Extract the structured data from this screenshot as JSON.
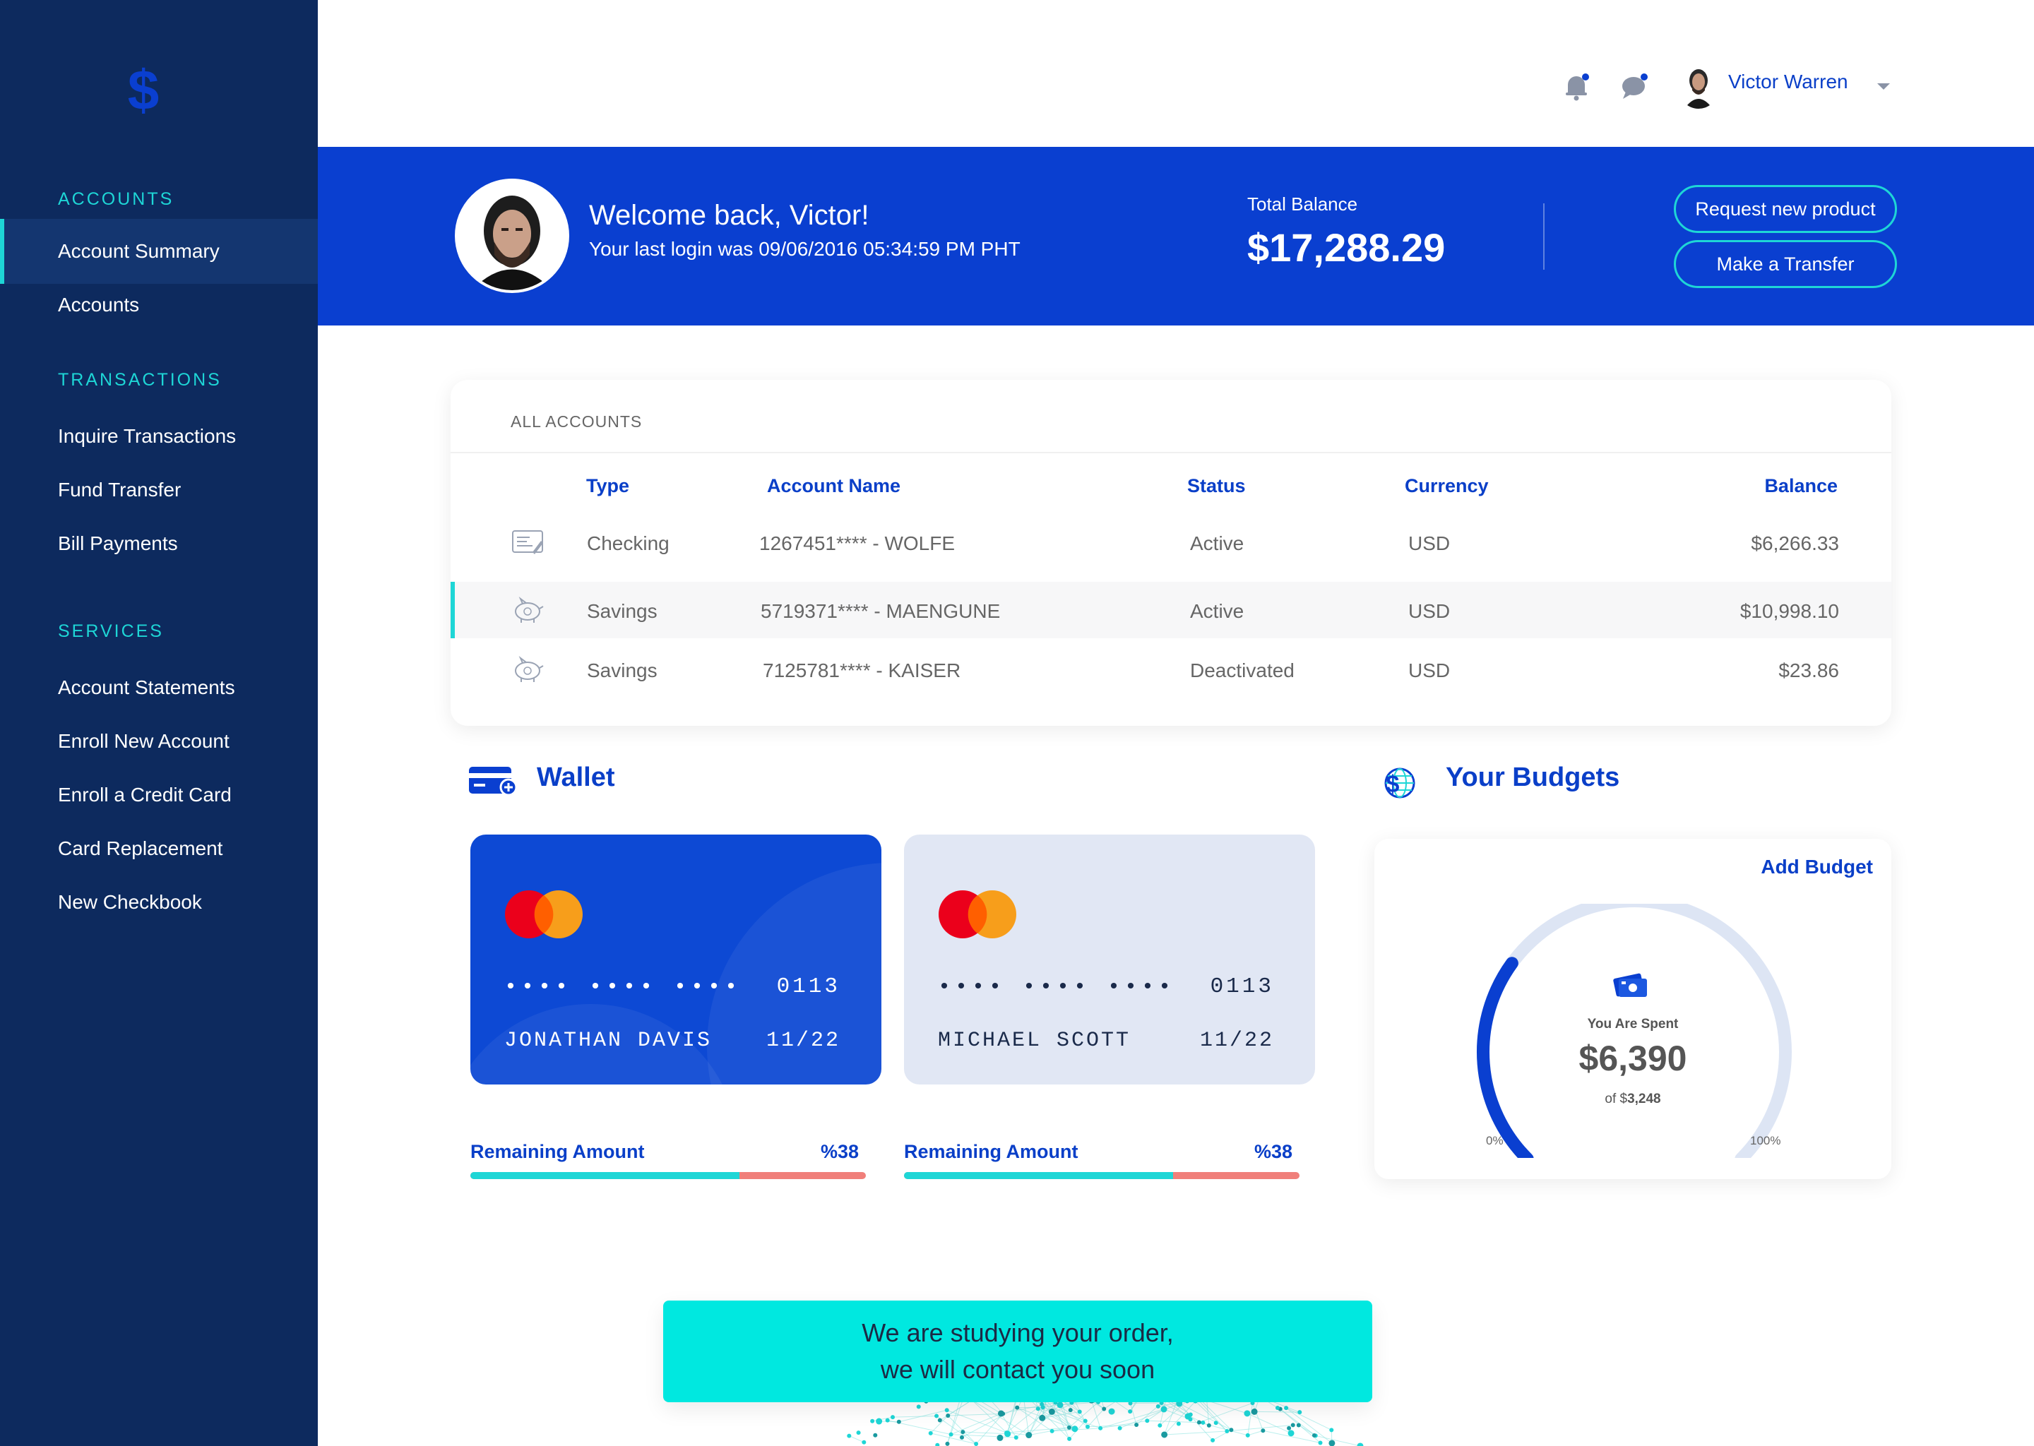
{
  "sidebar": {
    "sections": [
      {
        "title": "ACCOUNTS",
        "items": [
          "Account Summary",
          "Accounts"
        ]
      },
      {
        "title": "TRANSACTIONS",
        "items": [
          "Inquire Transactions",
          "Fund Transfer",
          "Bill Payments"
        ]
      },
      {
        "title": "SERVICES",
        "items": [
          "Account Statements",
          "Enroll New Account",
          "Enroll a Credit Card",
          "Card Replacement",
          "New Checkbook"
        ]
      }
    ],
    "active_item": "Account Summary"
  },
  "topbar": {
    "user_name": "Victor Warren",
    "icons": [
      "bell-icon",
      "chat-icon",
      "chevron-down-icon"
    ]
  },
  "banner": {
    "welcome": "Welcome back, Victor!",
    "last_login": "Your last login was 09/06/2016 05:34:59 PM PHT",
    "total_balance_label": "Total Balance",
    "total_balance": "$17,288.29",
    "request_button": "Request new product",
    "transfer_button": "Make a Transfer"
  },
  "accounts": {
    "title": "ALL ACCOUNTS",
    "headers": [
      "Type",
      "Account Name",
      "Status",
      "Currency",
      "Balance"
    ],
    "rows": [
      {
        "icon": "check-icon",
        "type": "Checking",
        "name": "1267451**** - WOLFE",
        "status": "Active",
        "currency": "USD",
        "balance": "$6,266.33"
      },
      {
        "icon": "piggy-bank-icon",
        "type": "Savings",
        "name": "5719371**** - MAENGUNE",
        "status": "Active",
        "currency": "USD",
        "balance": "$10,998.10"
      },
      {
        "icon": "piggy-bank-icon",
        "type": "Savings",
        "name": "7125781**** - KAISER",
        "status": "Deactivated",
        "currency": "USD",
        "balance": "$23.86"
      }
    ]
  },
  "wallet": {
    "title": "Wallet",
    "cards": [
      {
        "dots": "•••• •••• ••••",
        "last4": "0113",
        "holder": "JONATHAN DAVIS",
        "expiry": "11/22",
        "remaining_label": "Remaining Amount",
        "remaining_pct": "%38",
        "remaining_fraction": 0.68
      },
      {
        "dots": "•••• •••• ••••",
        "last4": "0113",
        "holder": "MICHAEL SCOTT",
        "expiry": "11/22",
        "remaining_label": "Remaining Amount",
        "remaining_pct": "%38",
        "remaining_fraction": 0.68
      }
    ]
  },
  "budgets": {
    "title": "Your Budgets",
    "add_label": "Add Budget",
    "spent_label": "You Are Spent",
    "spent_value": "$6,390",
    "of_prefix": "of $",
    "of_value": "3,248",
    "min_label": "0%",
    "max_label": "100%",
    "gauge_fraction": 0.3
  },
  "notice": {
    "line1": "We are studying your order,",
    "line2": "we will contact you soon"
  },
  "colors": {
    "sidebar": "#0d2a5e",
    "accent": "#0a3fd0",
    "teal": "#1ed6d6",
    "notice": "#00e8e0",
    "remaining_bar": "#f07f7a"
  }
}
